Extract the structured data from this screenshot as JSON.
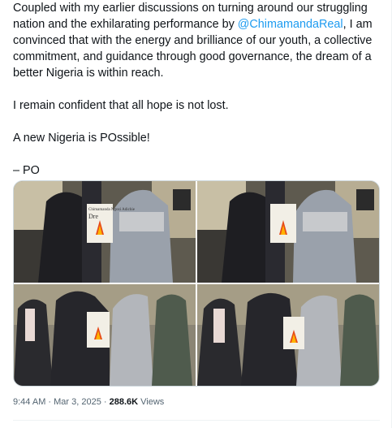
{
  "tweet": {
    "paragraph1_before": "Coupled with my earlier discussions on turning around our struggling nation and the exhilarating performance by ",
    "mention": "@ChimamandaReal",
    "paragraph1_after": ", I am convinced that with the energy and brilliance of our youth, a collective commitment, and guidance through good governance, the dream of a better Nigeria is within reach.",
    "paragraph2": "I remain confident that all hope is not lost.",
    "paragraph3": "A new Nigeria is POssible!",
    "signature": "– PO"
  },
  "media": {
    "photo_count": 4,
    "book_title": "Chimamanda Ngozi Adichie",
    "book_subtitle": "Dre"
  },
  "meta": {
    "time": "9:44 AM",
    "separator1": " · ",
    "date": "Mar 3, 2025",
    "separator2": " · ",
    "views_count": "288.6K",
    "views_label": " Views"
  },
  "colors": {
    "link": "#1d9bf0",
    "text": "#0f1419",
    "secondary": "#536471"
  }
}
